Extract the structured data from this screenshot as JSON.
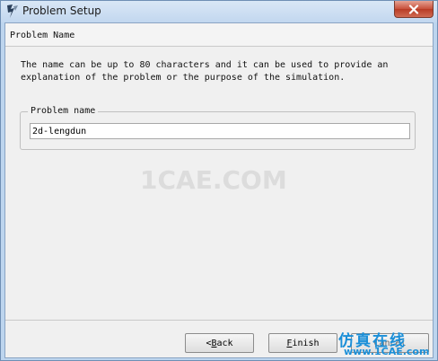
{
  "window": {
    "title": "Problem Setup",
    "close_glyph": "✕"
  },
  "header": {
    "title": "Problem Name"
  },
  "description": {
    "line1": "The name can be up to 80 characters and it can be used to provide an",
    "line2": "explanation of the problem or the purpose of the simulation."
  },
  "problem_name": {
    "group_label": "Problem name",
    "value": "2d-lengdun"
  },
  "buttons": {
    "back_prefix": "< ",
    "back_accel": "B",
    "back_rest": "ack",
    "finish_accel": "F",
    "finish_rest": "inish",
    "cancel_label": "Cancel"
  },
  "watermark": {
    "text": "1CAE.COM",
    "brand_cn": "仿真在线",
    "brand_url": "www.1CAE.com"
  },
  "colors": {
    "title_bar": "#c2d7ef",
    "close_button": "#c7503a",
    "dialog_bg": "#f0f0f0",
    "brand": "#1b8fd8"
  },
  "icons": {
    "app": "problem-setup-app-icon",
    "close": "close-icon"
  }
}
